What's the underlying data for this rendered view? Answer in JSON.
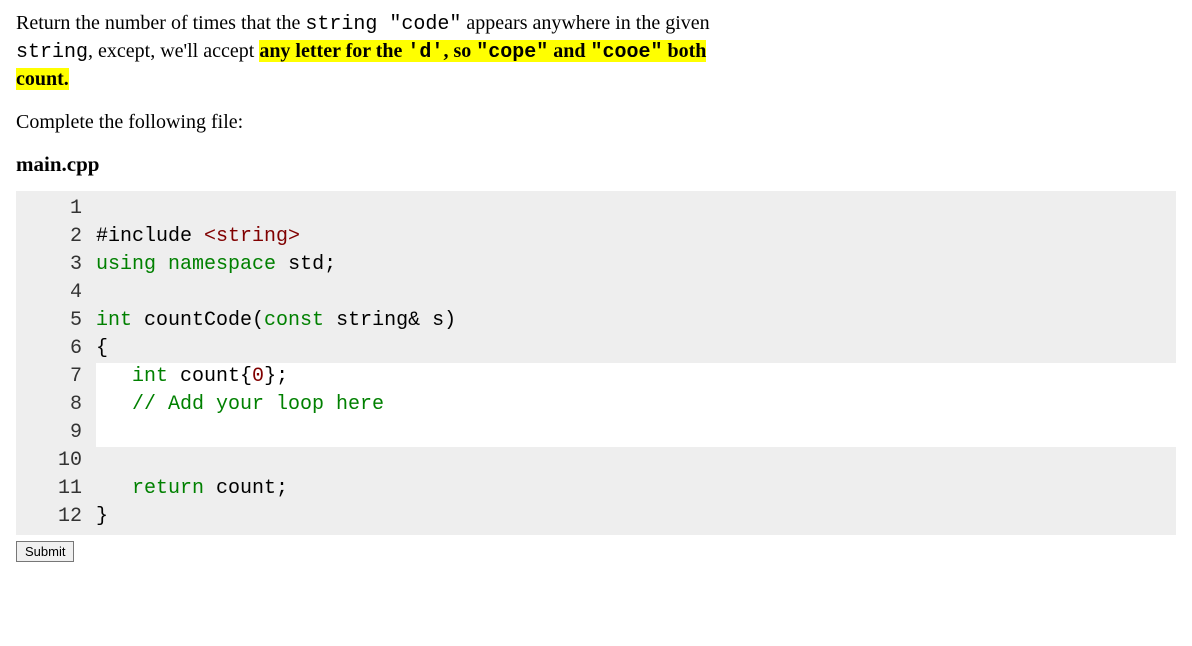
{
  "problem": {
    "p1a": "Return the number of times that the ",
    "p1b": "string \"code\"",
    "p1c": " appears anywhere in the given",
    "p2a": "string",
    "p2b": ", except, we'll accept ",
    "hl2": "any letter for the ",
    "hl2_code": "'d'",
    "hl2_tail": ", so ",
    "hl2_code2": "\"cope\"",
    "hl2_and": " and ",
    "hl2_code3": "\"cooe\"",
    "hl2_tail2": " both",
    "hl3": "count."
  },
  "instruction": "Complete the following file:",
  "filename": "main.cpp",
  "code": {
    "lines": [
      {
        "n": "1",
        "editable": false,
        "segs": [
          {
            "t": " ",
            "c": ""
          }
        ]
      },
      {
        "n": "2",
        "editable": false,
        "segs": [
          {
            "t": "#include ",
            "c": ""
          },
          {
            "t": "<string>",
            "c": "tok-inc"
          }
        ]
      },
      {
        "n": "3",
        "editable": false,
        "segs": [
          {
            "t": "using",
            "c": "tok-kw"
          },
          {
            "t": " ",
            "c": ""
          },
          {
            "t": "namespace",
            "c": "tok-kw"
          },
          {
            "t": " std;",
            "c": ""
          }
        ]
      },
      {
        "n": "4",
        "editable": false,
        "segs": [
          {
            "t": " ",
            "c": ""
          }
        ]
      },
      {
        "n": "5",
        "editable": false,
        "segs": [
          {
            "t": "int",
            "c": "tok-kw"
          },
          {
            "t": " countCode(",
            "c": ""
          },
          {
            "t": "const",
            "c": "tok-kw"
          },
          {
            "t": " string& s)",
            "c": ""
          }
        ]
      },
      {
        "n": "6",
        "editable": false,
        "segs": [
          {
            "t": "{",
            "c": ""
          }
        ]
      },
      {
        "n": "7",
        "editable": true,
        "segs": [
          {
            "t": "   ",
            "c": ""
          },
          {
            "t": "int",
            "c": "tok-kw"
          },
          {
            "t": " count{",
            "c": ""
          },
          {
            "t": "0",
            "c": "tok-num"
          },
          {
            "t": "};",
            "c": ""
          }
        ]
      },
      {
        "n": "8",
        "editable": true,
        "segs": [
          {
            "t": "   ",
            "c": ""
          },
          {
            "t": "// Add your loop here",
            "c": "tok-cmt"
          }
        ]
      },
      {
        "n": "9",
        "editable": true,
        "segs": [
          {
            "t": " ",
            "c": ""
          }
        ]
      },
      {
        "n": "10",
        "editable": false,
        "segs": [
          {
            "t": " ",
            "c": ""
          }
        ]
      },
      {
        "n": "11",
        "editable": false,
        "segs": [
          {
            "t": "   ",
            "c": ""
          },
          {
            "t": "return",
            "c": "tok-kw"
          },
          {
            "t": " count;",
            "c": ""
          }
        ]
      },
      {
        "n": "12",
        "editable": false,
        "segs": [
          {
            "t": "}",
            "c": ""
          }
        ]
      }
    ]
  },
  "submit_label": "Submit"
}
